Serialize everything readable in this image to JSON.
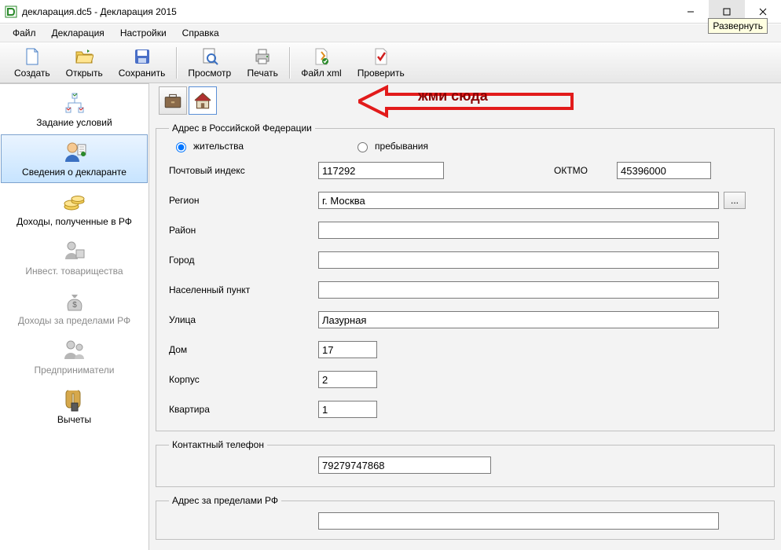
{
  "window": {
    "title": "декларация.dc5 - Декларация 2015",
    "tooltip_maximize": "Развернуть"
  },
  "menu": {
    "file": "Файл",
    "declaration": "Декларация",
    "settings": "Настройки",
    "help": "Справка"
  },
  "toolbar": {
    "create": "Создать",
    "open": "Открыть",
    "save": "Сохранить",
    "preview": "Просмотр",
    "print": "Печать",
    "filexml": "Файл xml",
    "check": "Проверить"
  },
  "nav": {
    "conditions": "Задание условий",
    "declarant": "Сведения о декларанте",
    "income_rf": "Доходы, полученные в РФ",
    "invest": "Инвест. товарищества",
    "income_foreign": "Доходы за пределами РФ",
    "entrepreneur": "Предприниматели",
    "deductions": "Вычеты"
  },
  "annotation": {
    "click_here": "жми сюда"
  },
  "group": {
    "address_rf": "Адрес в Российской Федерации",
    "phone": "Контактный телефон",
    "address_foreign": "Адрес за пределами РФ"
  },
  "radio": {
    "residence": "жительства",
    "stay": "пребывания"
  },
  "labels": {
    "postcode": "Почтовый индекс",
    "oktmo": "ОКТМО",
    "region": "Регион",
    "district": "Район",
    "city": "Город",
    "settlement": "Населенный пункт",
    "street": "Улица",
    "house": "Дом",
    "building": "Корпус",
    "flat": "Квартира"
  },
  "values": {
    "postcode": "117292",
    "oktmo": "45396000",
    "region": "г. Москва",
    "district": "",
    "city": "",
    "settlement": "",
    "street": "Лазурная",
    "house": "17",
    "building": "2",
    "flat": "1",
    "phone": "79279747868",
    "foreign_addr": ""
  },
  "dots": "..."
}
